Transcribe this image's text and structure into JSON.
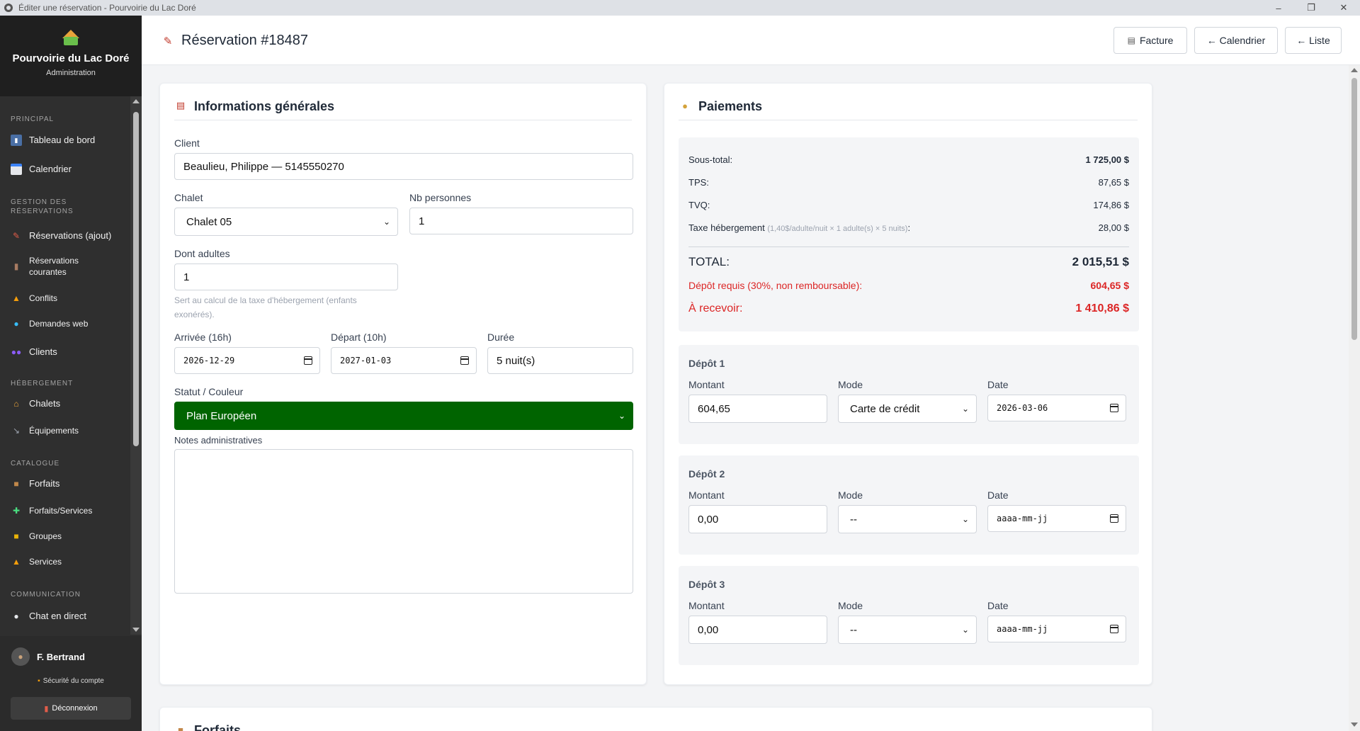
{
  "window": {
    "title": "Éditer une réservation - Pourvoirie du Lac Doré",
    "minimize": "–",
    "restore": "❐",
    "close": "✕"
  },
  "brand": {
    "name": "Pourvoirie du Lac Doré",
    "subtitle": "Administration"
  },
  "sidebar": {
    "sections": {
      "principal": "PRINCIPAL",
      "gestion": "GESTION DES RÉSERVATIONS",
      "hebergement": "HÉBERGEMENT",
      "catalogue": "CATALOGUE",
      "communication": "COMMUNICATION"
    },
    "items": [
      {
        "label": "Tableau de bord",
        "icon": "chart-icon"
      },
      {
        "label": "Calendrier",
        "icon": "calendar-icon"
      },
      {
        "label": "Réservations (ajout)",
        "icon": "pencil-icon"
      },
      {
        "label": "Réservations courantes",
        "icon": "clipboard-icon"
      },
      {
        "label": "Conflits",
        "icon": "warning-icon"
      },
      {
        "label": "Demandes web",
        "icon": "globe-icon"
      },
      {
        "label": "Clients",
        "icon": "users-icon"
      },
      {
        "label": "Chalets",
        "icon": "house-icon"
      },
      {
        "label": "Équipements",
        "icon": "wrench-icon"
      },
      {
        "label": "Forfaits",
        "icon": "package-icon"
      },
      {
        "label": "Forfaits/Services",
        "icon": "puzzle-icon"
      },
      {
        "label": "Groupes",
        "icon": "folder-icon"
      },
      {
        "label": "Services",
        "icon": "bell-icon"
      },
      {
        "label": "Chat en direct",
        "icon": "chat-icon"
      }
    ],
    "user": {
      "name": "F. Bertrand",
      "security": "Sécurité du compte",
      "logout": "Déconnexion"
    }
  },
  "header": {
    "title": "Réservation #18487",
    "buttons": {
      "facture": "Facture",
      "calendrier": "← Calendrier",
      "liste": "← Liste"
    }
  },
  "general": {
    "title": "Informations générales",
    "client_label": "Client",
    "client_value": "Beaulieu, Philippe — 5145550270",
    "chalet_label": "Chalet",
    "chalet_value": "Chalet 05",
    "nb_label": "Nb personnes",
    "nb_value": "1",
    "adults_label": "Dont adultes",
    "adults_value": "1",
    "adults_hint": "Sert au calcul de la taxe d'hébergement (enfants exonérés).",
    "arrival_label": "Arrivée (16h)",
    "arrival_value": "2026-12-29",
    "departure_label": "Départ (10h)",
    "departure_value": "2027-01-03",
    "duration_label": "Durée",
    "duration_value": "5 nuit(s)",
    "status_label": "Statut / Couleur",
    "status_value": "Plan Européen",
    "status_color": "#006400",
    "notes_label": "Notes administratives",
    "notes_value": ""
  },
  "payments": {
    "title": "Paiements",
    "subtotal_label": "Sous-total:",
    "subtotal_value": "1 725,00 $",
    "tps_label": "TPS:",
    "tps_value": "87,65 $",
    "tvq_label": "TVQ:",
    "tvq_value": "174,86 $",
    "lodging_label": "Taxe hébergement",
    "lodging_detail": "(1,40$/adulte/nuit × 1 adulte(s) × 5 nuits)",
    "lodging_colon": ":",
    "lodging_value": "28,00 $",
    "total_label": "TOTAL:",
    "total_value": "2 015,51 $",
    "deposit_req_label": "Dépôt requis (30%, non remboursable):",
    "deposit_req_value": "604,65 $",
    "receive_label": "À recevoir:",
    "receive_value": "1 410,86 $",
    "red_color": "#dc2626",
    "col_labels": {
      "amount": "Montant",
      "mode": "Mode",
      "date": "Date"
    },
    "deposits": [
      {
        "title": "Dépôt 1",
        "amount": "604,65",
        "mode": "Carte de crédit",
        "date": "2026-03-06"
      },
      {
        "title": "Dépôt 2",
        "amount": "0,00",
        "mode": "--",
        "date": "aaaa-mm-jj"
      },
      {
        "title": "Dépôt 3",
        "amount": "0,00",
        "mode": "--",
        "date": "aaaa-mm-jj"
      }
    ]
  },
  "forfaits": {
    "title": "Forfaits"
  }
}
